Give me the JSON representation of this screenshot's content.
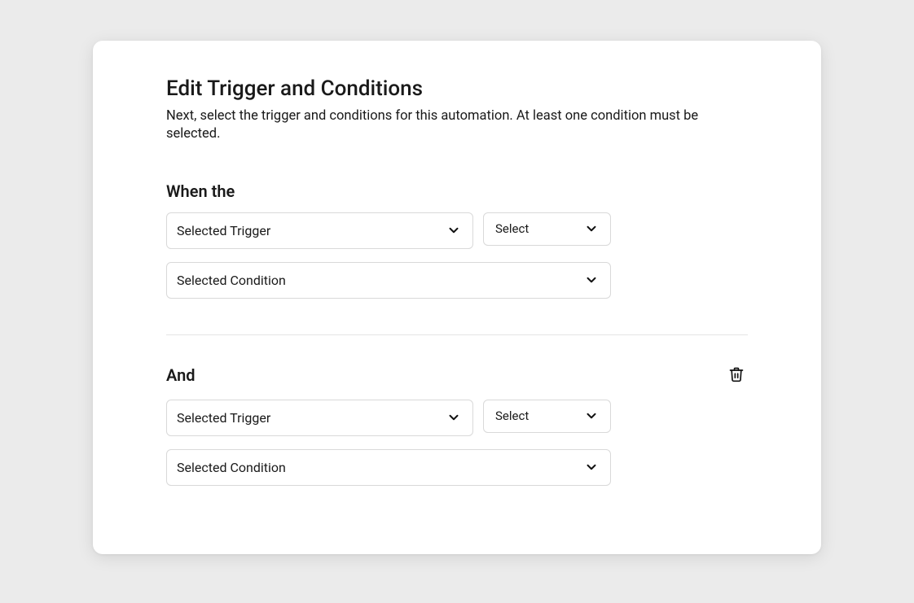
{
  "header": {
    "title": "Edit Trigger and Conditions",
    "subtitle": "Next, select the trigger and conditions for this automation. At least one condition must be selected."
  },
  "sections": [
    {
      "heading": "When the",
      "deletable": false,
      "trigger_value": "Selected Trigger",
      "select_value": "Select",
      "condition_value": "Selected Condition"
    },
    {
      "heading": "And",
      "deletable": true,
      "trigger_value": "Selected Trigger",
      "select_value": "Select",
      "condition_value": "Selected Condition"
    }
  ]
}
